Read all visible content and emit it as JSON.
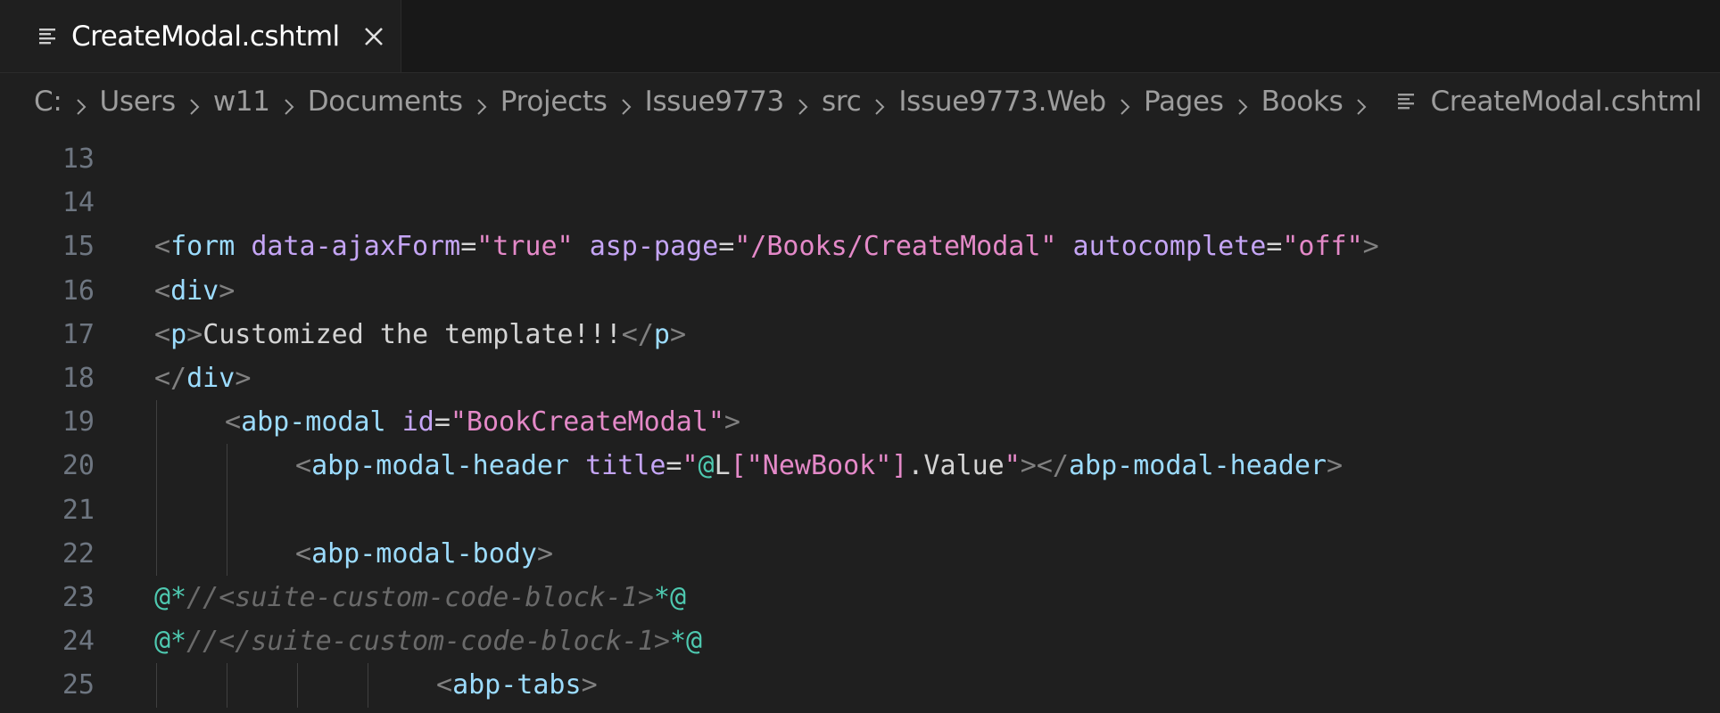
{
  "tab": {
    "title": "CreateModal.cshtml",
    "file_icon": "file-lines-icon",
    "close_icon": "close-icon"
  },
  "breadcrumb": {
    "items": [
      "C:",
      "Users",
      "w11",
      "Documents",
      "Projects",
      "Issue9773",
      "src",
      "Issue9773.Web",
      "Pages",
      "Books"
    ],
    "file": "CreateModal.cshtml"
  },
  "editor": {
    "lines": [
      {
        "n": "13",
        "indent": 0,
        "tokens": []
      },
      {
        "n": "14",
        "indent": 0,
        "tokens": []
      },
      {
        "n": "15",
        "indent": 0,
        "tokens": [
          {
            "c": "t-punct",
            "t": "<"
          },
          {
            "c": "t-tag2",
            "t": "form"
          },
          {
            "c": "t-white",
            "t": " "
          },
          {
            "c": "t-attr",
            "t": "data-ajaxForm"
          },
          {
            "c": "t-white",
            "t": "="
          },
          {
            "c": "t-str",
            "t": "\"true\""
          },
          {
            "c": "t-white",
            "t": " "
          },
          {
            "c": "t-attr",
            "t": "asp-page"
          },
          {
            "c": "t-white",
            "t": "="
          },
          {
            "c": "t-str",
            "t": "\"/Books/CreateModal\""
          },
          {
            "c": "t-white",
            "t": " "
          },
          {
            "c": "t-attr",
            "t": "autocomplete"
          },
          {
            "c": "t-white",
            "t": "="
          },
          {
            "c": "t-str",
            "t": "\"off\""
          },
          {
            "c": "t-punct",
            "t": ">"
          }
        ]
      },
      {
        "n": "16",
        "indent": 0,
        "tokens": [
          {
            "c": "t-punct",
            "t": "<"
          },
          {
            "c": "t-tag2",
            "t": "div"
          },
          {
            "c": "t-punct",
            "t": ">"
          }
        ]
      },
      {
        "n": "17",
        "indent": 0,
        "tokens": [
          {
            "c": "t-punct",
            "t": "<"
          },
          {
            "c": "t-tag2",
            "t": "p"
          },
          {
            "c": "t-punct",
            "t": ">"
          },
          {
            "c": "t-text",
            "t": "Customized the template!!!"
          },
          {
            "c": "t-punct",
            "t": "</"
          },
          {
            "c": "t-tag2",
            "t": "p"
          },
          {
            "c": "t-punct",
            "t": ">"
          }
        ]
      },
      {
        "n": "18",
        "indent": 0,
        "tokens": [
          {
            "c": "t-punct",
            "t": "</"
          },
          {
            "c": "t-tag2",
            "t": "div"
          },
          {
            "c": "t-punct",
            "t": ">"
          }
        ]
      },
      {
        "n": "19",
        "indent": 1,
        "tokens": [
          {
            "c": "t-punct",
            "t": "<"
          },
          {
            "c": "t-tag2",
            "t": "abp-modal"
          },
          {
            "c": "t-white",
            "t": " "
          },
          {
            "c": "t-attr",
            "t": "id"
          },
          {
            "c": "t-white",
            "t": "="
          },
          {
            "c": "t-str",
            "t": "\"BookCreateModal\""
          },
          {
            "c": "t-punct",
            "t": ">"
          }
        ]
      },
      {
        "n": "20",
        "indent": 2,
        "tokens": [
          {
            "c": "t-punct",
            "t": "<"
          },
          {
            "c": "t-tag2",
            "t": "abp-modal-header"
          },
          {
            "c": "t-white",
            "t": " "
          },
          {
            "c": "t-attr",
            "t": "title"
          },
          {
            "c": "t-white",
            "t": "="
          },
          {
            "c": "t-str",
            "t": "\""
          },
          {
            "c": "t-raz",
            "t": "@"
          },
          {
            "c": "t-white",
            "t": "L"
          },
          {
            "c": "t-str",
            "t": "["
          },
          {
            "c": "t-str",
            "t": "\"NewBook\""
          },
          {
            "c": "t-str",
            "t": "]"
          },
          {
            "c": "t-white",
            "t": ".Value"
          },
          {
            "c": "t-str",
            "t": "\""
          },
          {
            "c": "t-punct",
            "t": "></"
          },
          {
            "c": "t-tag2",
            "t": "abp-modal-header"
          },
          {
            "c": "t-punct",
            "t": ">"
          }
        ]
      },
      {
        "n": "21",
        "indent": 2,
        "tokens": []
      },
      {
        "n": "22",
        "indent": 2,
        "tokens": [
          {
            "c": "t-punct",
            "t": "<"
          },
          {
            "c": "t-tag2",
            "t": "abp-modal-body"
          },
          {
            "c": "t-punct",
            "t": ">"
          }
        ]
      },
      {
        "n": "23",
        "indent": 0,
        "tokens": [
          {
            "c": "t-raz",
            "t": "@*"
          },
          {
            "c": "t-cmt",
            "t": "//<suite-custom-code-block-1>"
          },
          {
            "c": "t-raz",
            "t": "*@"
          }
        ]
      },
      {
        "n": "24",
        "indent": 0,
        "tokens": [
          {
            "c": "t-raz",
            "t": "@*"
          },
          {
            "c": "t-cmt",
            "t": "//</suite-custom-code-block-1>"
          },
          {
            "c": "t-raz",
            "t": "*@"
          }
        ]
      },
      {
        "n": "25",
        "indent": 4,
        "tokens": [
          {
            "c": "t-punct",
            "t": "<"
          },
          {
            "c": "t-tag2",
            "t": "abp-tabs"
          },
          {
            "c": "t-punct",
            "t": ">"
          }
        ]
      }
    ]
  }
}
